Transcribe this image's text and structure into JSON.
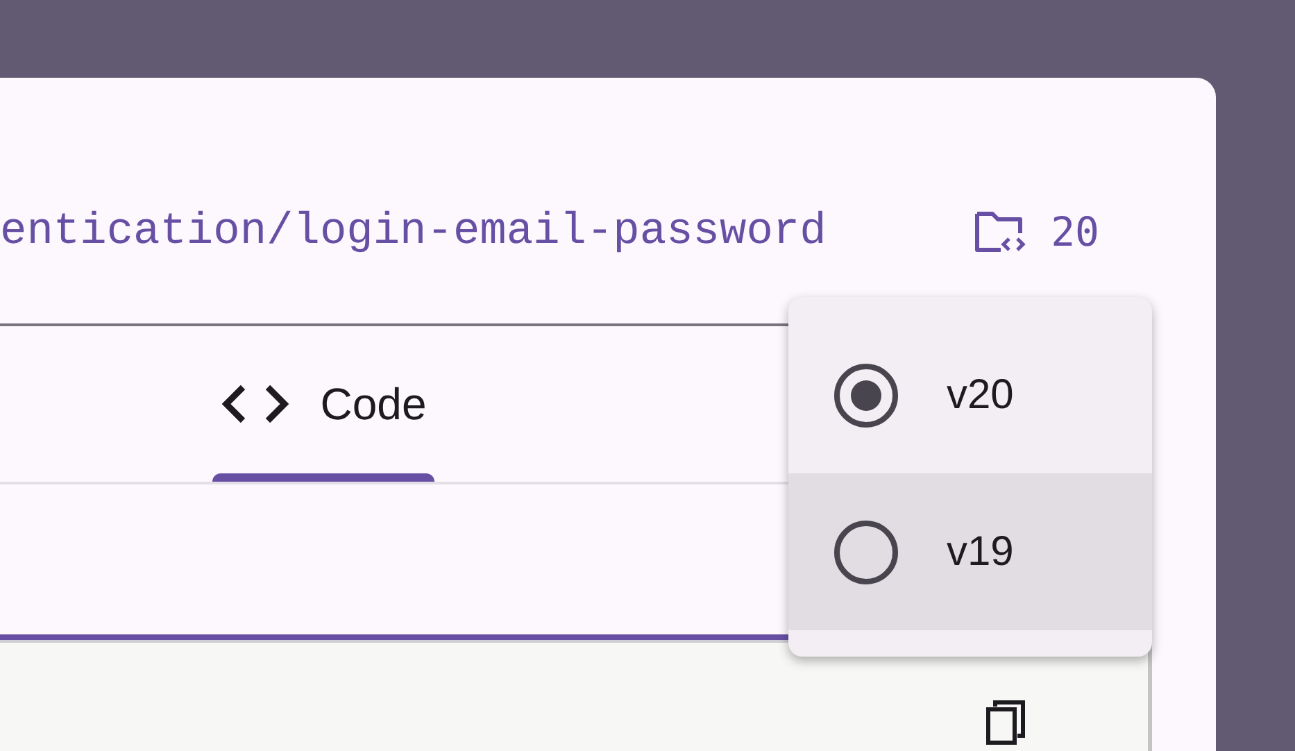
{
  "header": {
    "path": "entication/login-email-password",
    "version": "20"
  },
  "tabs": [
    {
      "label": "Code",
      "selected": true
    }
  ],
  "version_menu": {
    "items": [
      {
        "label": "v20",
        "selected": true,
        "hovered": false
      },
      {
        "label": "v19",
        "selected": false,
        "hovered": true
      }
    ]
  }
}
